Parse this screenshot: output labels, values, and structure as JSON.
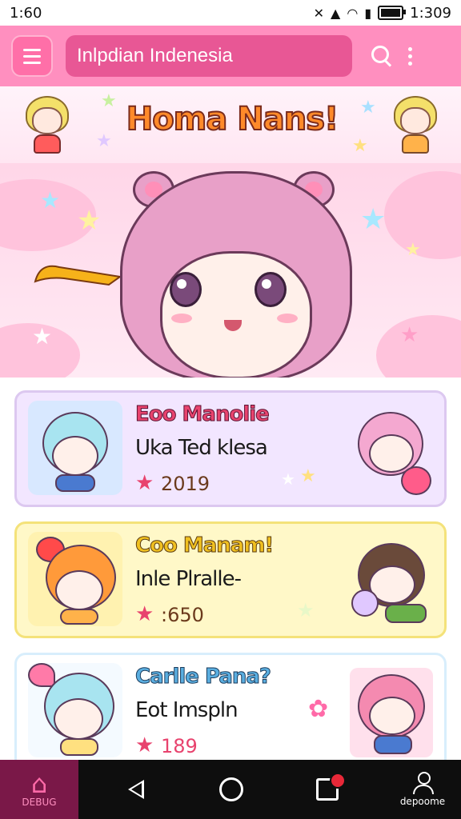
{
  "status_bar": {
    "time_left": "1:60",
    "time_right": "1:309"
  },
  "search": {
    "value": "Inlpdian Indenesia"
  },
  "banner": {
    "title": "Homa Nans!"
  },
  "cards": [
    {
      "name": "Eoo Manolie",
      "subtitle": "Uka Ted klesa",
      "count": "2019",
      "accent": "#e8436e",
      "bg": "#f2e6ff",
      "border": "#dcc8f0"
    },
    {
      "name": "Coo Manam!",
      "subtitle": "Inle Plralle-",
      "count": ":650",
      "accent": "#f0c020",
      "bg": "#fff8c8",
      "border": "#f4e27a"
    },
    {
      "name": "Carlle Pana?",
      "subtitle": "Eot Imspln",
      "count": "189",
      "accent": "#5aaee0",
      "bg": "#ffffff",
      "border": "#d8eefc"
    }
  ],
  "nav": {
    "home_label": "DEBUG",
    "profile_label": "depoome"
  },
  "colors": {
    "appbar": "#ff8fbf",
    "search_bg": "#e85795",
    "navbar": "#0e0e0e"
  }
}
